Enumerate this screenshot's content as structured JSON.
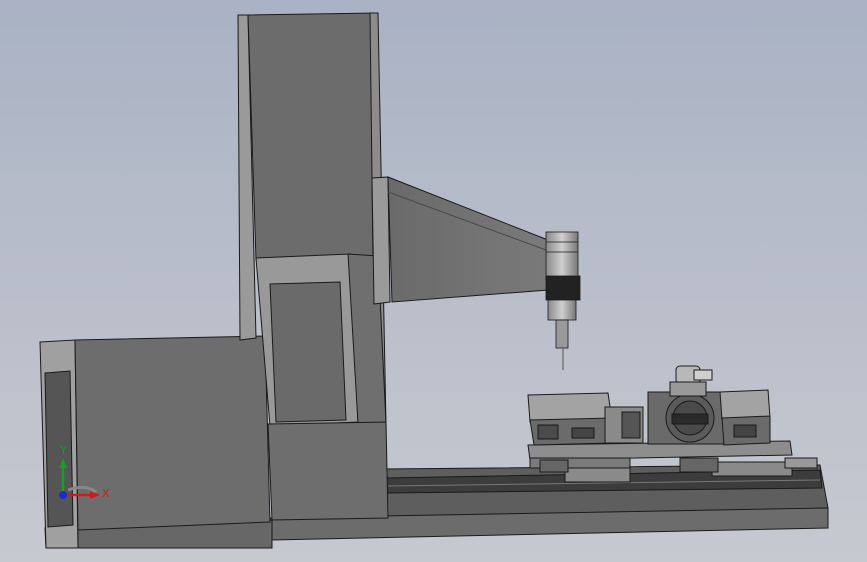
{
  "triad": {
    "x_label": "X",
    "y_label": "Y",
    "x_color": "#c81e1e",
    "y_color": "#1c9a2c",
    "z_color": "#1d2bd0"
  },
  "colors": {
    "body": "#6f6f6f",
    "body_light": "#9a9a9a",
    "body_dark": "#565656",
    "edge": "#1a1a1a",
    "rail": "#3c3c3c"
  },
  "icons": {
    "triad": "coordinate-triad-icon"
  }
}
